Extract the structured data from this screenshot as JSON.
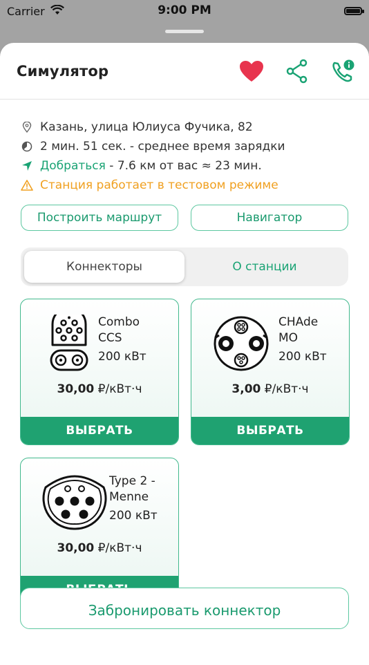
{
  "status_bar": {
    "carrier": "Carrier",
    "time": "9:00 PM"
  },
  "header": {
    "title": "Симулятор",
    "icons": [
      "heart-icon",
      "share-icon",
      "phone-info-icon"
    ]
  },
  "station": {
    "address": "Казань, улица Юлиуса Фучика, 82",
    "avg_charge": "2 мин. 51 сек. - среднее время зарядки",
    "route_link": "Добраться",
    "route_info": " - 7.6 км от вас ≈ 23 мин.",
    "warning": "Станция работает в тестовом режиме"
  },
  "actions": {
    "route": "Построить маршрут",
    "navigator": "Навигатор"
  },
  "tabs": [
    {
      "label": "Коннекторы",
      "active": true
    },
    {
      "label": "О станции",
      "active": false
    }
  ],
  "connectors": [
    {
      "name": "Combo\nCCS",
      "power": "200 кВт",
      "price_value": "30,00",
      "price_unit": " ₽/кВт·ч",
      "button": "ВЫБРАТЬ"
    },
    {
      "name": "CHAde\nMO",
      "power": "200 кВт",
      "price_value": "3,00",
      "price_unit": " ₽/кВт·ч",
      "button": "ВЫБРАТЬ"
    },
    {
      "name": "Type 2 -\nMenne",
      "power": "200 кВт",
      "price_value": "30,00",
      "price_unit": " ₽/кВт·ч",
      "button": "ВЫБРАТЬ"
    }
  ],
  "book_button": "Забронировать коннектор",
  "colors": {
    "accent": "#1fa271",
    "heart": "#e8344e",
    "warning": "#f0a020"
  }
}
